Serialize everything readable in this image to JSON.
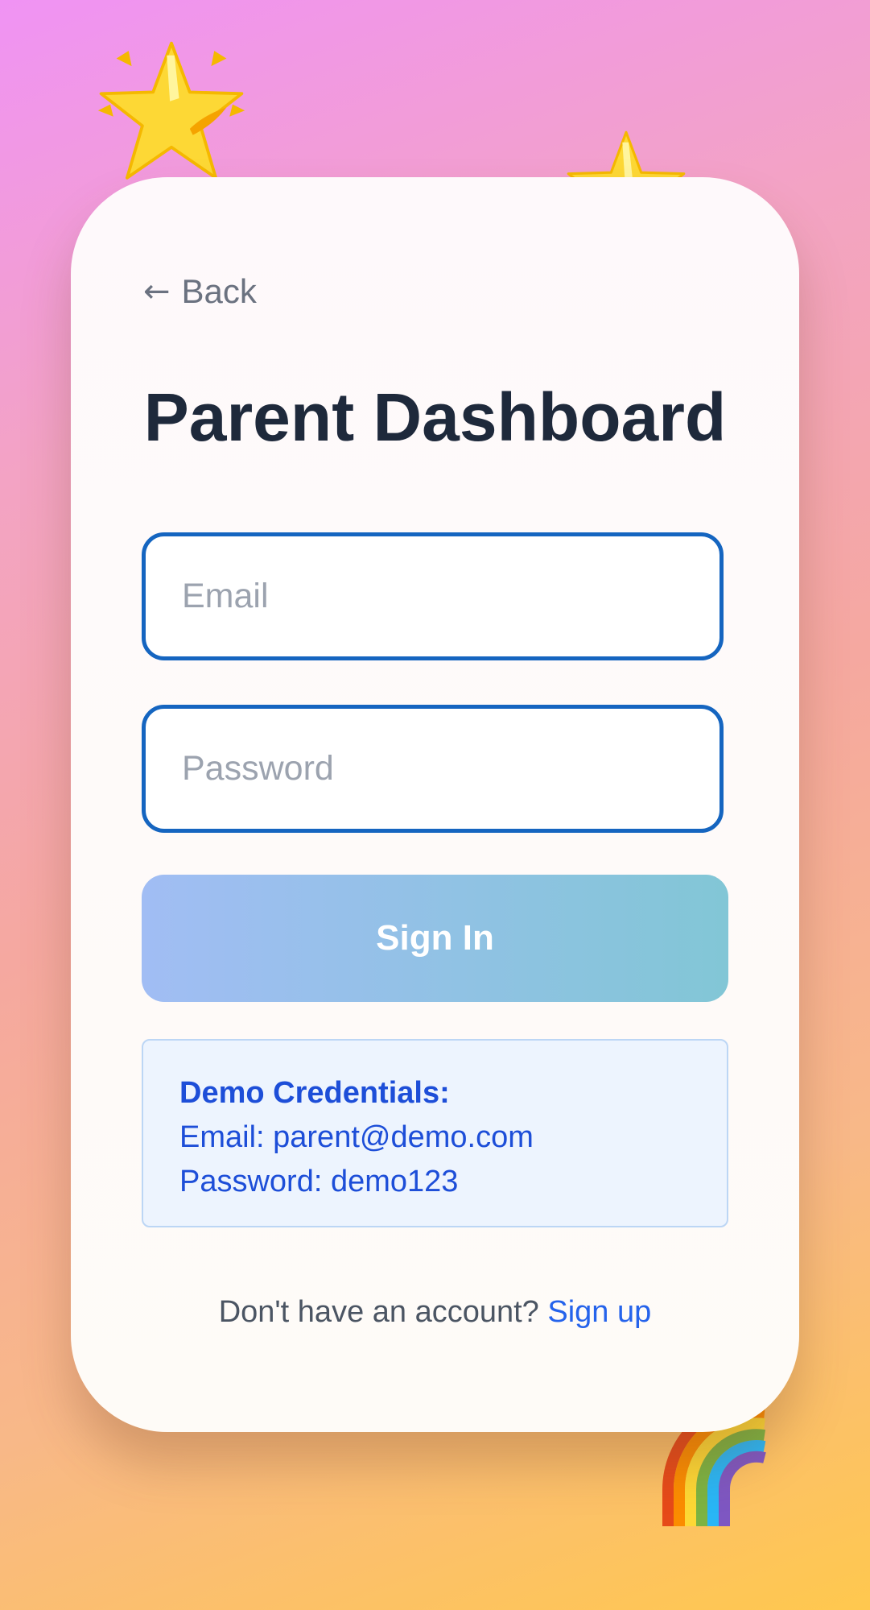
{
  "decorations": {
    "star_large_icon": "star-icon",
    "star_small_icon": "star-icon",
    "rainbow_icon": "rainbow-icon"
  },
  "back": {
    "arrow": "←",
    "label": "Back"
  },
  "page_title": "Parent Dashboard",
  "form": {
    "email_placeholder": "Email",
    "email_value": "",
    "password_placeholder": "Password",
    "password_value": "",
    "submit_label": "Sign In"
  },
  "demo": {
    "heading": "Demo Credentials:",
    "email_line": "Email: parent@demo.com",
    "password_line": "Password: demo123"
  },
  "footer": {
    "prompt": "Don't have an account?",
    "link_label": "Sign up"
  },
  "colors": {
    "accent": "#1565c0",
    "link": "#2563eb",
    "title": "#1e293b",
    "demo_text": "#1d4ed8"
  }
}
